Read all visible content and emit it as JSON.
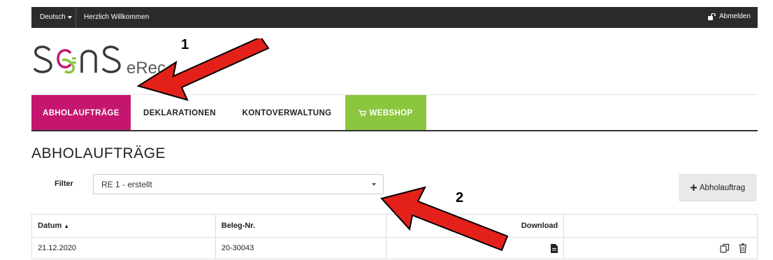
{
  "topbar": {
    "language": "Deutsch",
    "welcome": "Herzlich Willkommen",
    "logout": "Abmelden"
  },
  "logo": {
    "text": "SONS",
    "subtitle": "eRec"
  },
  "nav": {
    "tabs": [
      {
        "label": "ABHOLAUFTRÄGE",
        "active": true
      },
      {
        "label": "DEKLARATIONEN",
        "active": false
      },
      {
        "label": "KONTOVERWALTUNG",
        "active": false
      },
      {
        "label": "WEBSHOP",
        "active": false
      }
    ]
  },
  "main": {
    "title": "ABHOLAUFTRÄGE",
    "filter_label": "Filter",
    "filter_value": "RE 1 - erstellt",
    "add_button": "Abholauftrag"
  },
  "table": {
    "headers": [
      "Datum",
      "Beleg-Nr.",
      "Download",
      ""
    ],
    "rows": [
      {
        "datum": "21.12.2020",
        "beleg": "20-30043"
      }
    ]
  },
  "callouts": [
    "1",
    "2"
  ],
  "colors": {
    "topbar": "#2b2b2b",
    "active_tab": "#c4166f",
    "webshop_tab": "#8cc63f",
    "arrow": "#e4201b",
    "logo_accent": "#c4166f",
    "logo_plug": "#8cc63f"
  },
  "icons": {
    "logout": "unlock-icon",
    "webshop": "cart-icon",
    "download": "file-icon",
    "copy": "copy-icon",
    "delete": "trash-icon",
    "sort": "sort-up-icon",
    "add": "plus-icon"
  }
}
